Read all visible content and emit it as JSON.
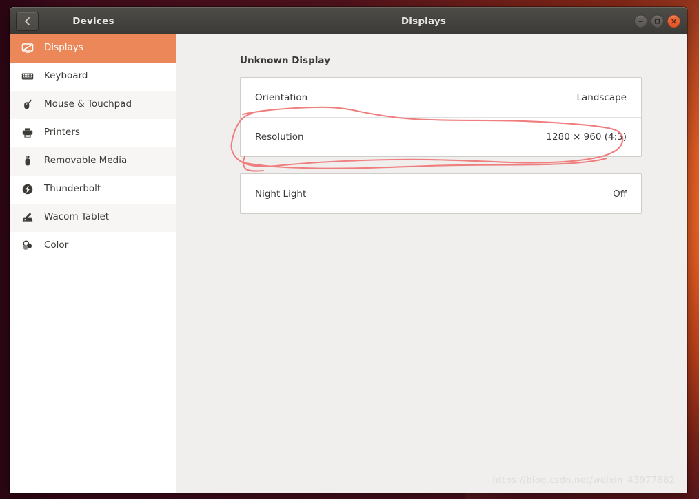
{
  "window": {
    "panel_title": "Devices",
    "title": "Displays",
    "back_icon": "chevron-left-icon",
    "controls": [
      {
        "name": "minimize",
        "icon": "minimize-icon"
      },
      {
        "name": "maximize",
        "icon": "maximize-icon"
      },
      {
        "name": "close",
        "icon": "close-icon"
      }
    ],
    "colors": {
      "titlebar": "#464440",
      "accent": "#ec8759",
      "close_button": "#e05428",
      "content_bg": "#f1efee"
    }
  },
  "sidebar": {
    "items": [
      {
        "label": "Displays",
        "icon": "display-icon",
        "selected": true
      },
      {
        "label": "Keyboard",
        "icon": "keyboard-icon",
        "selected": false
      },
      {
        "label": "Mouse & Touchpad",
        "icon": "mouse-icon",
        "selected": false
      },
      {
        "label": "Printers",
        "icon": "printer-icon",
        "selected": false
      },
      {
        "label": "Removable Media",
        "icon": "usb-drive-icon",
        "selected": false
      },
      {
        "label": "Thunderbolt",
        "icon": "thunderbolt-icon",
        "selected": false
      },
      {
        "label": "Wacom Tablet",
        "icon": "wacom-tablet-icon",
        "selected": false
      },
      {
        "label": "Color",
        "icon": "color-circles-icon",
        "selected": false
      }
    ]
  },
  "main": {
    "heading": "Unknown Display",
    "panels": [
      {
        "name": "display-settings-panel",
        "rows": [
          {
            "label": "Orientation",
            "value": "Landscape"
          },
          {
            "label": "Resolution",
            "value": "1280 × 960 (4:3)",
            "highlighted": true
          }
        ]
      },
      {
        "name": "night-light-panel",
        "rows": [
          {
            "label": "Night Light",
            "value": "Off"
          }
        ]
      }
    ]
  },
  "annotation": {
    "type": "hand-drawn-ellipse",
    "color": "#ef7f7f",
    "target": "Resolution"
  },
  "watermark": {
    "text": "https://blog.csdn.net/weixin_43977682"
  }
}
